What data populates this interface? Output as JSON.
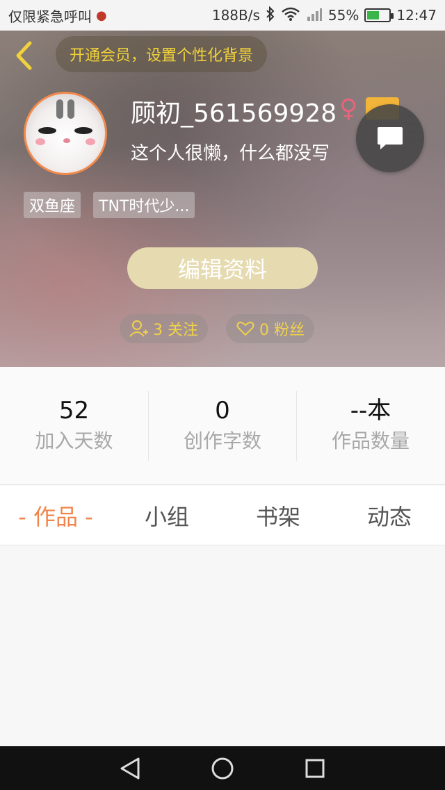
{
  "status_bar": {
    "carrier": "仅限紧急呼叫",
    "speed": "188B/s",
    "battery": "55%",
    "battery_level": 0.55,
    "time": "12:47"
  },
  "header": {
    "vip_banner": "开通会员，设置个性化背景",
    "username": "顾初_561569928",
    "gender_symbol": "♀",
    "bio": "这个人很懒，什么都没写",
    "tags": [
      "双鱼座",
      "TNT时代少..."
    ],
    "edit_button": "编辑资料",
    "following": "3 关注",
    "followers": "0 粉丝"
  },
  "stats": [
    {
      "value": "52",
      "label": "加入天数"
    },
    {
      "value": "0",
      "label": "创作字数"
    },
    {
      "value": "--本",
      "label": "作品数量"
    }
  ],
  "tabs": [
    "- 作品 -",
    "小组",
    "书架",
    "动态"
  ],
  "colors": {
    "accent": "#f0844a",
    "vip_text": "#f2d23a",
    "edit_button_bg": "#e6dab0"
  }
}
